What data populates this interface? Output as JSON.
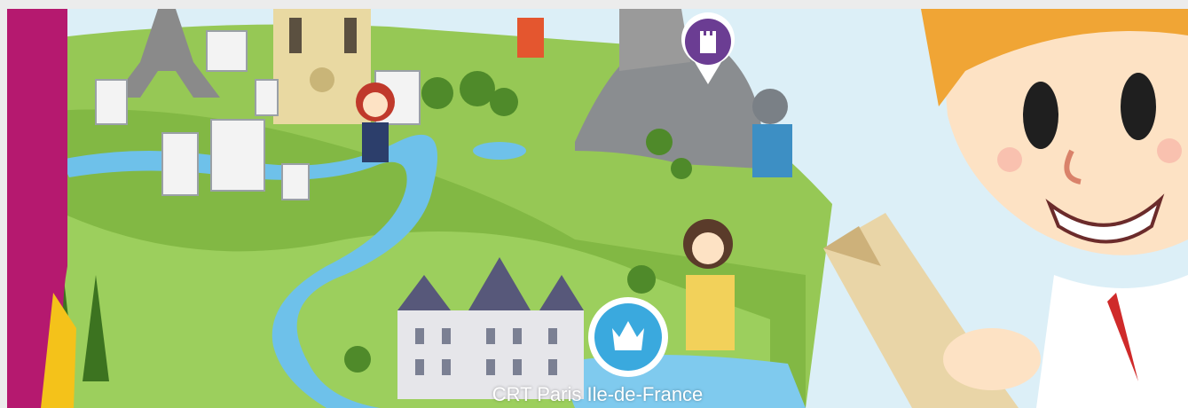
{
  "image": {
    "caption": "CRT Paris Ile-de-France",
    "alt": "Illustrated children's map of Paris region with castles, characters and a smiling boy holding a map"
  },
  "colors": {
    "magenta_band": "#b5196f",
    "yellow_band": "#f4c21a",
    "sky": "#dceff7",
    "grass": "#8fc24c",
    "river": "#6ec1ea",
    "rock": "#8a8d90",
    "pin_purple": "#6b3d93",
    "pin_blue": "#3aa9de",
    "boy_hair": "#f0a535",
    "boy_skin": "#fde2c4"
  },
  "icons": [
    "tower-pin-icon",
    "crown-pin-icon"
  ]
}
